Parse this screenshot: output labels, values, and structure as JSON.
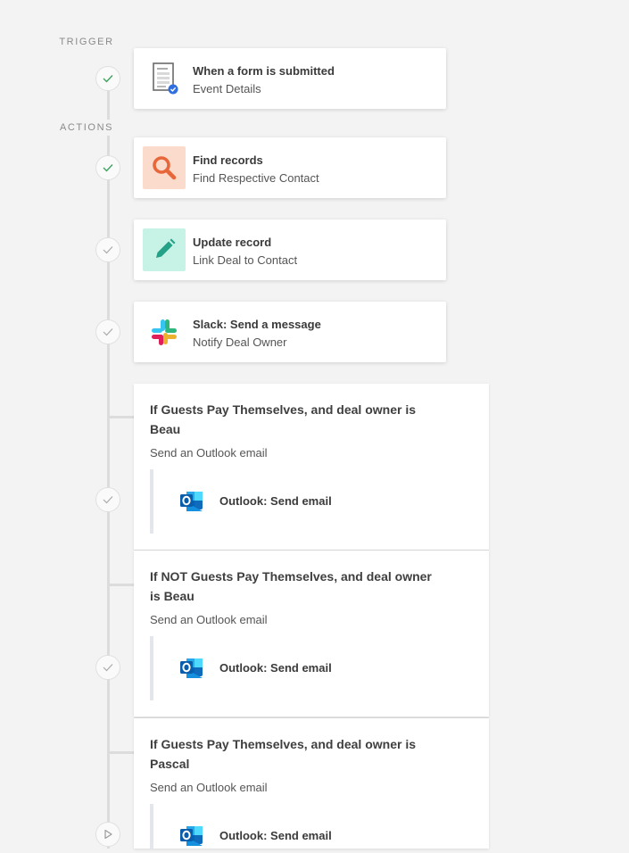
{
  "trigger": {
    "label": "TRIGGER",
    "title": "When a form is submitted",
    "subtitle": "Event Details",
    "icon": "form-document-icon"
  },
  "actions_label": "ACTIONS",
  "actions": [
    {
      "title": "Find records",
      "subtitle": "Find Respective Contact",
      "icon": "search-icon",
      "icon_bg": "#fbdccc",
      "icon_color": "#e8673a"
    },
    {
      "title": "Update record",
      "subtitle": "Link Deal to Contact",
      "icon": "pencil-icon",
      "icon_bg": "#c7f2e6",
      "icon_color": "#24a186"
    },
    {
      "title": "Slack: Send a message",
      "subtitle": "Notify Deal Owner",
      "icon": "slack-icon"
    }
  ],
  "paths": [
    {
      "title": "If Guests Pay Themselves, and deal owner is Beau",
      "subtitle": "Send an Outlook email",
      "step": "Outlook: Send email",
      "icon": "outlook-icon"
    },
    {
      "title": "If NOT Guests Pay Themselves, and deal owner is Beau",
      "subtitle": "Send an Outlook email",
      "step": "Outlook: Send email",
      "icon": "outlook-icon"
    },
    {
      "title": "If Guests Pay Themselves, and deal owner is Pascal",
      "subtitle": "Send an Outlook email",
      "step": "Outlook: Send email",
      "icon": "outlook-icon"
    }
  ],
  "colors": {
    "check": "#3fa35f",
    "muted_check": "#a9a9a9"
  }
}
